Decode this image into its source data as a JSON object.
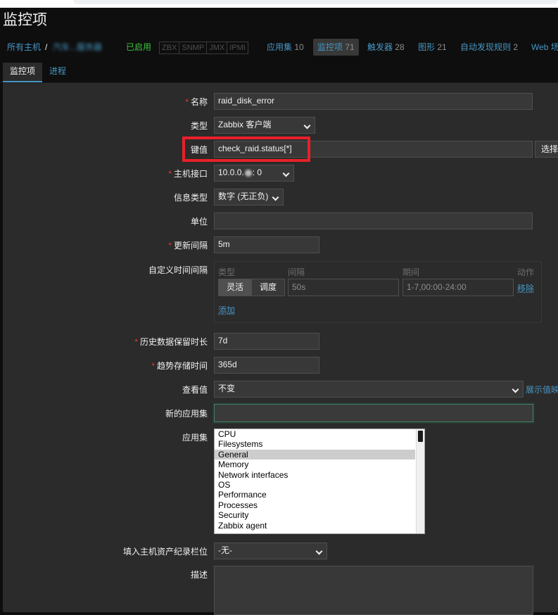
{
  "page": {
    "title": "监控项"
  },
  "breadcrumb": {
    "all_hosts": "所有主机",
    "separator": "/",
    "host_name": "汽车...服务器",
    "status": "已启用",
    "availability": [
      "ZBX",
      "SNMP",
      "JMX",
      "IPMI"
    ],
    "links": [
      {
        "label": "应用集",
        "count": "10"
      },
      {
        "label": "监控项",
        "count": "71"
      },
      {
        "label": "触发器",
        "count": "28"
      },
      {
        "label": "图形",
        "count": "21"
      },
      {
        "label": "自动发现规则",
        "count": "2"
      },
      {
        "label": "Web 场"
      }
    ]
  },
  "tabs": [
    {
      "label": "监控项"
    },
    {
      "label": "进程"
    }
  ],
  "form": {
    "name": {
      "label": "名称",
      "value": "raid_disk_error"
    },
    "type": {
      "label": "类型",
      "value": "Zabbix 客户端"
    },
    "key": {
      "label": "键值",
      "value": "check_raid.status[*]",
      "button": "选择"
    },
    "interface": {
      "label": "主机接口",
      "value_prefix": "10.0.0.",
      "value_suffix": ": 0"
    },
    "info_type": {
      "label": "信息类型",
      "value": "数字 (无正负)"
    },
    "units": {
      "label": "单位",
      "value": ""
    },
    "update_interval": {
      "label": "更新间隔",
      "value": "5m"
    },
    "custom_intervals": {
      "label": "自定义时间间隔",
      "headers": {
        "type": "类型",
        "interval": "间隔",
        "period": "期间",
        "action": "动作"
      },
      "row": {
        "flexible": "灵活",
        "scheduling": "调度",
        "interval": "50s",
        "period": "1-7,00:00-24:00",
        "remove": "移除"
      },
      "add": "添加"
    },
    "history": {
      "label": "历史数据保留时长",
      "value": "7d"
    },
    "trends": {
      "label": "趋势存储时间",
      "value": "365d"
    },
    "show_value": {
      "label": "查看值",
      "value": "不变",
      "link": "展示值映"
    },
    "new_application": {
      "label": "新的应用集",
      "value": ""
    },
    "applications": {
      "label": "应用集",
      "options": [
        "CPU",
        "Filesystems",
        "General",
        "Memory",
        "Network interfaces",
        "OS",
        "Performance",
        "Processes",
        "Security",
        "Zabbix agent"
      ],
      "selected": "General"
    },
    "inventory": {
      "label": "填入主机资产纪录栏位",
      "value": "-无-"
    },
    "description": {
      "label": "描述",
      "value": ""
    }
  },
  "colors": {
    "required": "#e33734",
    "link": "#4796c4",
    "enabled": "#3cc23c",
    "highlight": "#e8202a"
  }
}
